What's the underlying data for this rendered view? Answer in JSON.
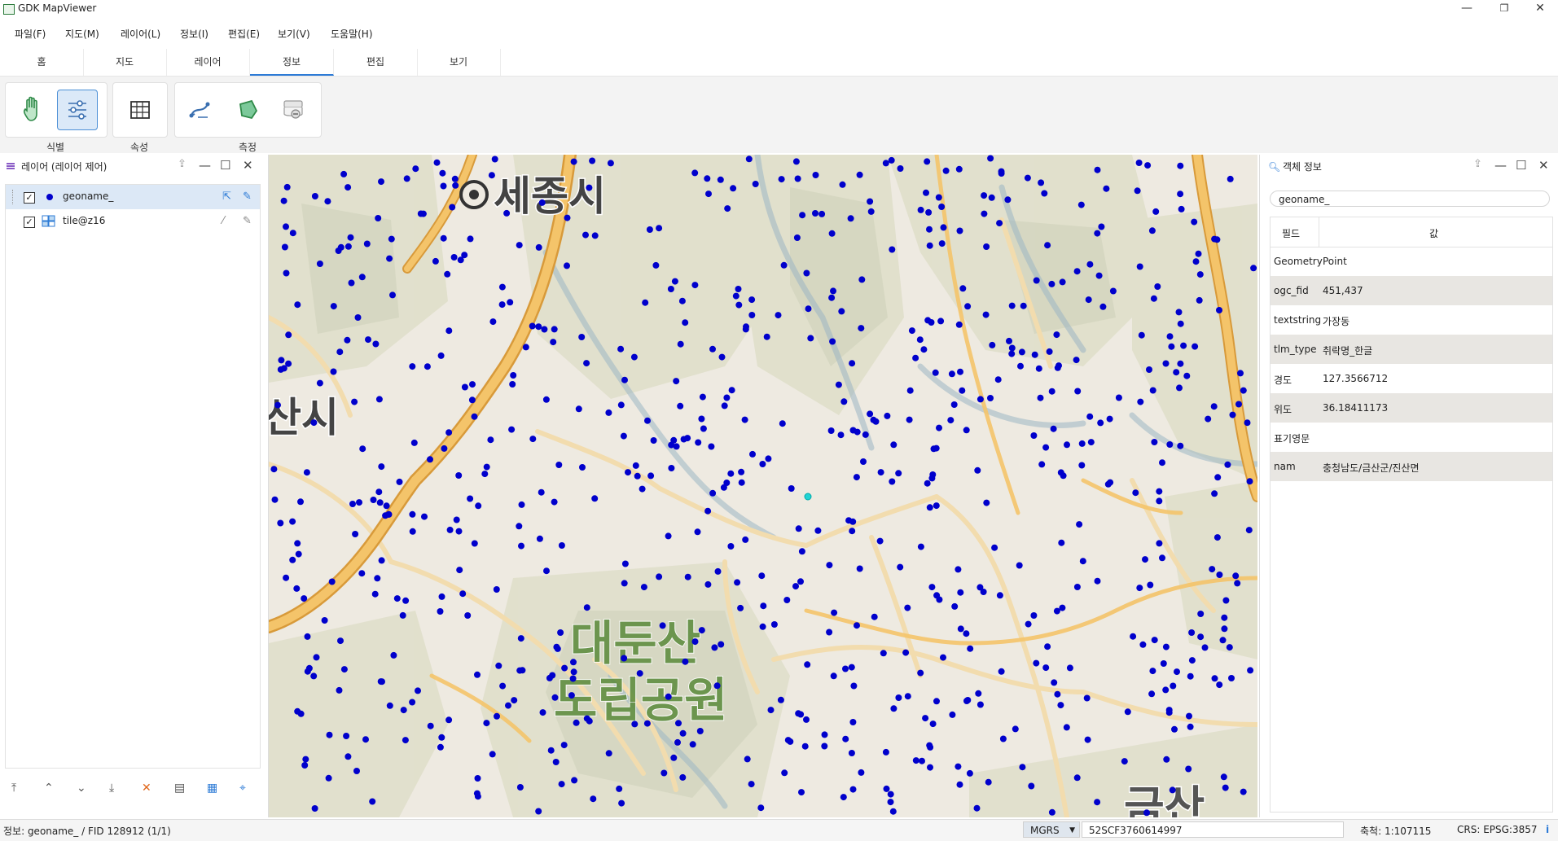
{
  "window": {
    "title": "GDK MapViewer",
    "minimize": "—",
    "restore": "❐",
    "close": "✕"
  },
  "menu": [
    "파일(F)",
    "지도(M)",
    "레이어(L)",
    "정보(I)",
    "편집(E)",
    "보기(V)",
    "도움말(H)"
  ],
  "tabs": {
    "items": [
      "홈",
      "지도",
      "레이어",
      "정보",
      "편집",
      "보기"
    ],
    "active": "정보"
  },
  "ribbon": {
    "groups": [
      {
        "label": "식별"
      },
      {
        "label": "속성"
      },
      {
        "label": "측정"
      }
    ]
  },
  "layer_panel": {
    "title": "레이어 (레이어 제어)",
    "layers": [
      {
        "name": "geoname_",
        "checked": true
      },
      {
        "name": "tile@z16",
        "checked": true
      }
    ]
  },
  "map": {
    "labels": {
      "city_top": "세종시",
      "city_left": "산시",
      "park_line1": "대둔산",
      "park_line2": "도립공원",
      "bottom_right": "금산"
    },
    "colors": {
      "point": "#0000cc",
      "selected_point": "#22d3d3",
      "road_fill": "#f4c46a",
      "road_casing": "#d89a3a",
      "minor_road": "#f2dcae",
      "land": "#eeeae1",
      "forest": "#dcdcc8",
      "valley": "#9db6c4"
    }
  },
  "info_panel": {
    "title": "객체 정보",
    "layer": "geoname_",
    "headers": {
      "field": "필드",
      "value": "값"
    },
    "rows": [
      {
        "field": "Geometry",
        "value": "Point"
      },
      {
        "field": "ogc_fid",
        "value": "451,437"
      },
      {
        "field": "textstring",
        "value": "가장동"
      },
      {
        "field": "tlm_type",
        "value": "취락명_한글"
      },
      {
        "field": "경도",
        "value": "127.3566712"
      },
      {
        "field": "위도",
        "value": "36.18411173"
      },
      {
        "field": "표기영문",
        "value": ""
      },
      {
        "field": "nam",
        "value": "충청남도/금산군/진산면"
      }
    ]
  },
  "status": {
    "info": "정보: geoname_ / FID 128912 (1/1)",
    "coord_system": "MGRS",
    "coord": "52SCF3760614997",
    "scale": "축척: 1:107115",
    "crs": "CRS: EPSG:3857",
    "info_icon": "i"
  }
}
